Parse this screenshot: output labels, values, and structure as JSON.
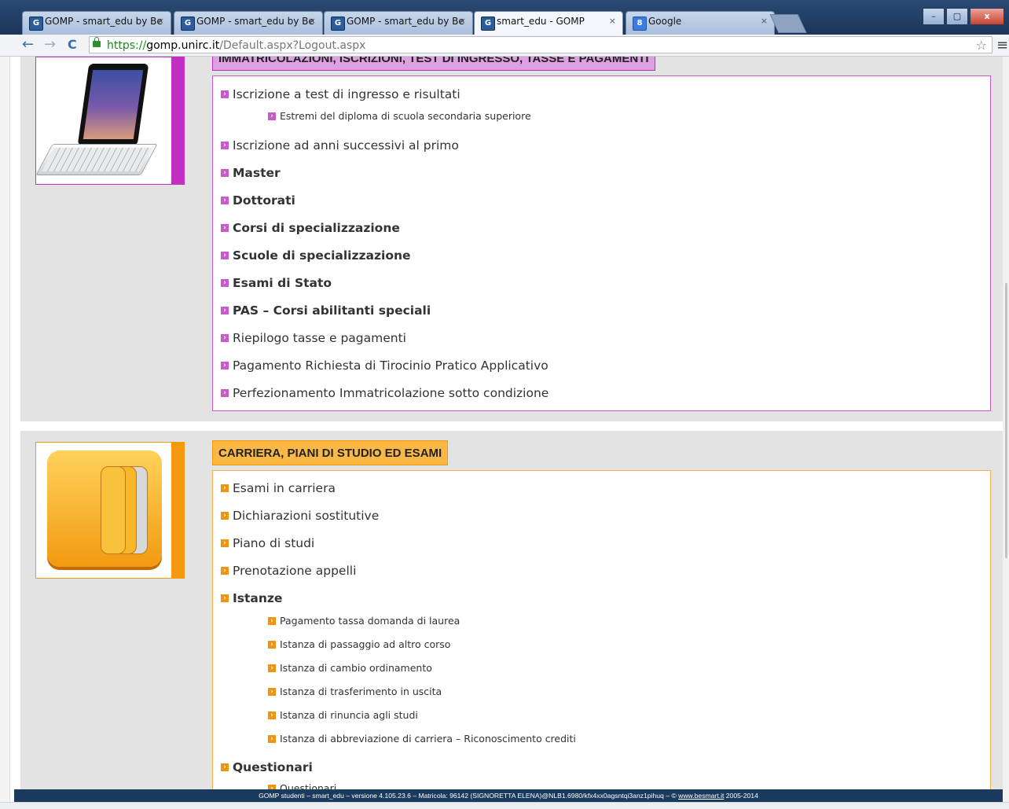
{
  "browser": {
    "tabs": [
      {
        "title": "GOMP - smart_edu by Be",
        "icon": "gomp-favicon",
        "active": false
      },
      {
        "title": "GOMP - smart_edu by Be",
        "icon": "gomp-favicon",
        "active": false
      },
      {
        "title": "GOMP - smart_edu by Be",
        "icon": "gomp-favicon",
        "active": false
      },
      {
        "title": "smart_edu - GOMP",
        "icon": "gomp-favicon",
        "active": true
      },
      {
        "title": "Google",
        "icon": "google-favicon",
        "active": false
      }
    ],
    "url": {
      "scheme": "https://",
      "host": "gomp.unirc.it",
      "path": "/Default.aspx?Logout.aspx"
    },
    "window_buttons": {
      "minimize": "–",
      "maximize": "▢",
      "close": "x"
    },
    "nav": {
      "back": "←",
      "forward": "→",
      "reload": "C"
    }
  },
  "section1": {
    "header": "IMMATRICOLAZIONI, ISCRIZIONI, TEST DI INGRESSO, TASSE E PAGAMENTI",
    "accent_color": "#c22fc2",
    "header_bg": "#dda0e0",
    "items": [
      {
        "label": "Iscrizione a test di ingresso e risultati",
        "bold": false
      },
      {
        "label": "Estremi del diploma di scuola secondaria superiore",
        "bold": false,
        "sub": true
      },
      {
        "label": "Iscrizione ad anni successivi al primo",
        "bold": false
      },
      {
        "label": "Master",
        "bold": true
      },
      {
        "label": "Dottorati",
        "bold": true
      },
      {
        "label": "Corsi di specializzazione",
        "bold": true
      },
      {
        "label": "Scuole di specializzazione",
        "bold": true
      },
      {
        "label": "Esami di Stato",
        "bold": true
      },
      {
        "label": "PAS – Corsi abilitanti speciali",
        "bold": true
      },
      {
        "label": "Riepilogo tasse e pagamenti",
        "bold": false
      },
      {
        "label": "Pagamento Richiesta di Tirocinio Pratico Applicativo",
        "bold": false
      },
      {
        "label": "Perfezionamento Immatricolazione sotto condizione",
        "bold": false
      }
    ]
  },
  "section2": {
    "header": "CARRIERA, PIANI DI STUDIO ED ESAMI",
    "accent_color": "#f5990f",
    "header_bg": "#fbb845",
    "items": [
      {
        "label": "Esami in carriera",
        "bold": false
      },
      {
        "label": "Dichiarazioni sostitutive",
        "bold": false
      },
      {
        "label": "Piano di studi",
        "bold": false
      },
      {
        "label": "Prenotazione appelli",
        "bold": false
      },
      {
        "label": "Istanze",
        "bold": true
      },
      {
        "label": "Pagamento tassa domanda di laurea",
        "sub": true
      },
      {
        "label": "Istanza di passaggio ad altro corso",
        "sub": true
      },
      {
        "label": "Istanza di cambio ordinamento",
        "sub": true
      },
      {
        "label": "Istanza di trasferimento in uscita",
        "sub": true
      },
      {
        "label": "Istanza di rinuncia agli studi",
        "sub": true
      },
      {
        "label": "Istanza di abbreviazione di carriera – Riconoscimento crediti",
        "sub": true
      },
      {
        "label": "Questionari",
        "bold": true
      },
      {
        "label": "Questionari",
        "sub": true
      }
    ]
  },
  "footer": {
    "text": "GOMP studenti – smart_edu – versione 4.105.23.6 – Matricola: 96142 (SIGNORETTA ELENA)@NLB1.6980/kfx4xx0agsntqi3anz1pihuq – © ",
    "link": "www.besmart.it",
    "years": " 2005-2014"
  }
}
